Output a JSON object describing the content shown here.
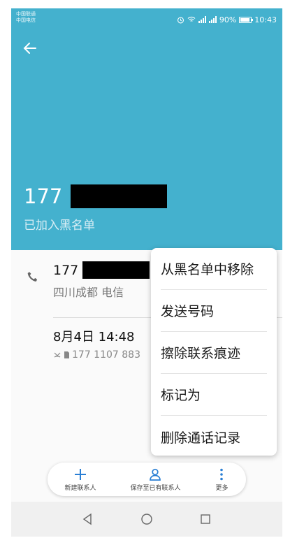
{
  "status_bar": {
    "carrier_1": "中国联通",
    "carrier_2": "中国电信",
    "battery": "90%",
    "time": "10:43"
  },
  "contact": {
    "number_prefix": "177",
    "status": "已加入黑名单",
    "location": "四川成都 电信"
  },
  "call_log": {
    "date": "8月4日 14:48",
    "number": "177 1107 883"
  },
  "menu": {
    "items": [
      "从黑名单中移除",
      "发送号码",
      "擦除联系痕迹",
      "标记为",
      "删除通话记录"
    ]
  },
  "actions": {
    "new_contact": "新建联系人",
    "save_existing": "保存至已有联系人",
    "more": "更多"
  },
  "colors": {
    "header": "#44b1ce",
    "accent": "#2a7fd4"
  }
}
